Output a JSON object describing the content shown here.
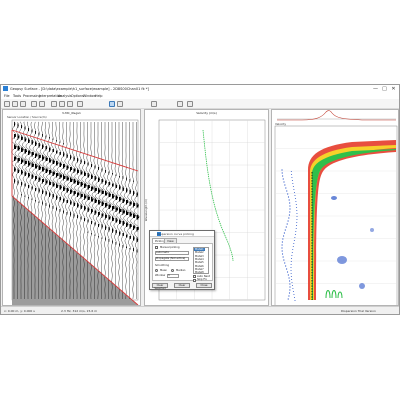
{
  "window": {
    "title": "Geopsy Surface - [D:\\data\\example\\h1_surface\\example] - 2D8S00Chan01 fk *]",
    "minimize": "—",
    "maximize": "□",
    "close": "✕"
  },
  "menu": [
    "File",
    "Tools",
    "Processing",
    "Interpretation",
    "Analysis",
    "Options",
    "Window",
    "Help"
  ],
  "toolbar": {
    "icons": [
      "open-icon",
      "save-icon",
      "print-icon",
      "undo-icon",
      "redo-icon",
      "zoom-in-icon",
      "zoom-out-icon",
      "pan-icon",
      "pick-icon",
      "select-icon",
      "cursor-icon",
      "grid-icon",
      "color-icon",
      "settings-icon"
    ]
  },
  "seismic": {
    "title": "V-MC_0&gs1",
    "subtitle": "Sensor Location / Source(m)"
  },
  "dispersion": {
    "title": "Velocity (m/s)",
    "ylabel": "Wavelength (m)"
  },
  "spectrum": {
    "title": "Velocity"
  },
  "dialog": {
    "title": "Dispersion curve picking",
    "tabs": [
      "Picking",
      "View"
    ],
    "options": [
      "Manual picking",
      "Automatic",
      "Propagate (Not active)"
    ],
    "smoothing_label": "Smoothing",
    "radios": [
      "Mean",
      "Median"
    ],
    "window_label": "Window",
    "window_value": "3",
    "models": [
      "Model1",
      "Model2",
      "Model3",
      "Model4",
      "Model5",
      "Model6",
      "Model7",
      "Model8"
    ],
    "checks": [
      "Auto Next",
      "Skip Fix",
      "Label"
    ],
    "buttons": [
      "Clear Selected",
      "Clear",
      "Close"
    ]
  },
  "status": {
    "left": "x: 0.00 m, y: 0.000 s",
    "mid": "2.3 Hz, 312 m/s, 15.6 m",
    "right": "Dispersion   Trial Version"
  },
  "colors": {
    "red_lines": "#d63a3a",
    "curve": "#2fbf4a",
    "hot": "#e53b2a",
    "warm": "#f6d12a",
    "cold": "#2a54c8"
  }
}
